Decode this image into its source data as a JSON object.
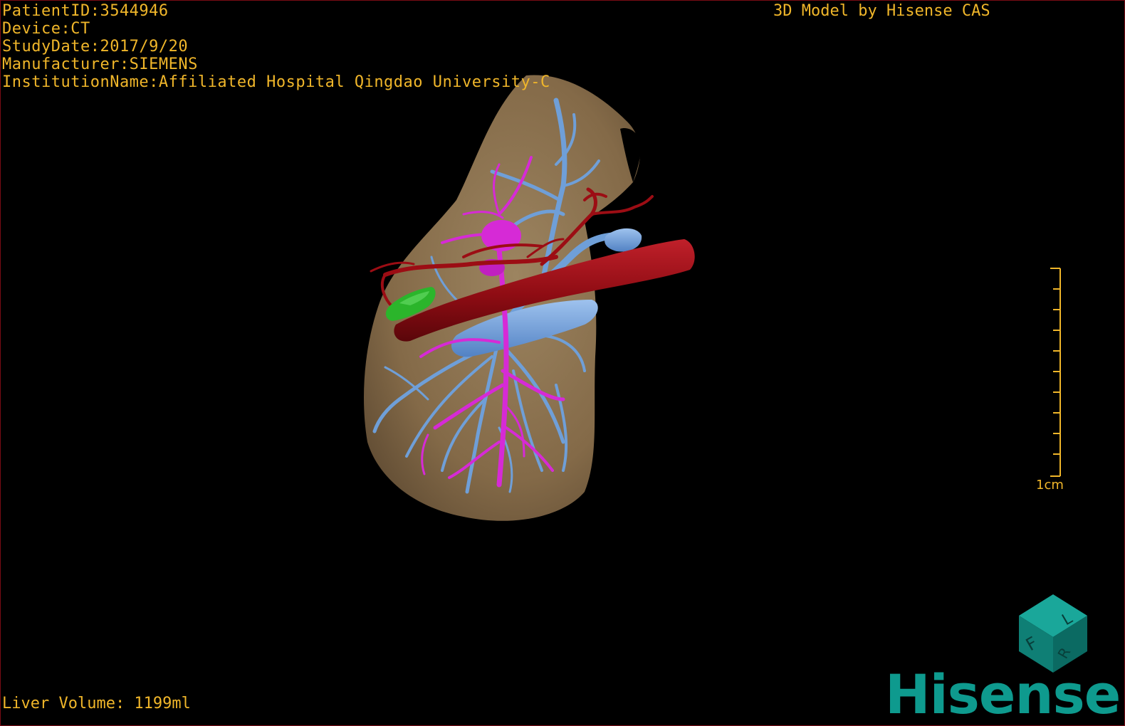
{
  "header": {
    "patient_id": "PatientID:3544946",
    "device": "Device:CT",
    "study_date": "StudyDate:2017/9/20",
    "manufacturer": "Manufacturer:SIEMENS",
    "institution": "InstitutionName:Affiliated Hospital Qingdao University-C",
    "title": "3D Model by Hisense CAS"
  },
  "footer": {
    "liver_volume": "Liver Volume: 1199ml"
  },
  "scale_bar": {
    "label": "1cm"
  },
  "orientation_cube": {
    "letters": [
      "F",
      "L",
      "R"
    ]
  },
  "brand": {
    "logo_text": "Hisense"
  },
  "colors": {
    "overlay_text": "#f0b62a",
    "liver": "#8c7250",
    "portal_vein": "#6f9fd8",
    "hepatic_vein": "#d62ad6",
    "artery_ivc": "#9c0d14",
    "lesion": "#2bb52b",
    "brand": "#0e9a8e",
    "border": "#7a0b14"
  },
  "icons": [
    "liver-model",
    "scale-bar",
    "orientation-cube-icon",
    "hisense-logo"
  ]
}
